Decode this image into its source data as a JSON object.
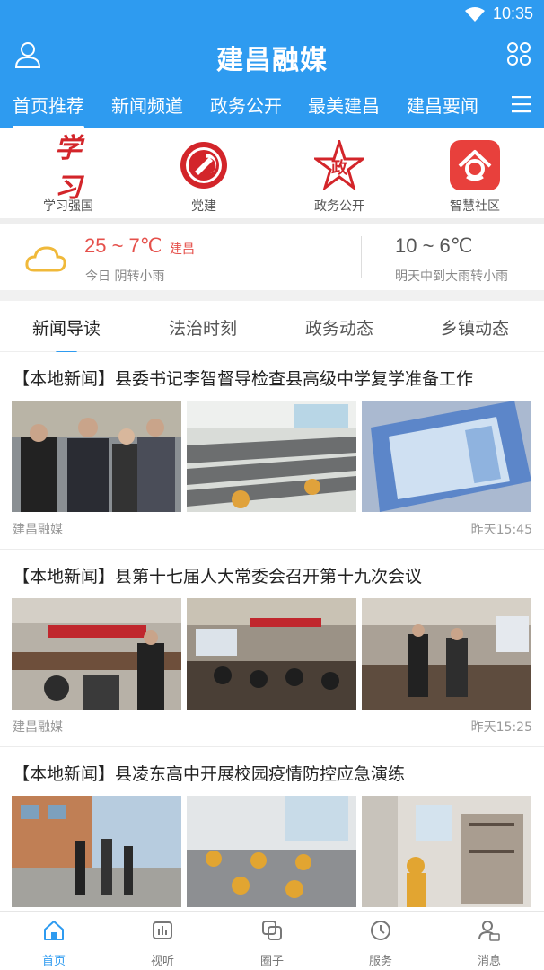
{
  "status_bar": {
    "time": "10:35"
  },
  "header": {
    "title": "建昌融媒"
  },
  "nav_tabs": [
    {
      "label": "首页推荐",
      "active": true
    },
    {
      "label": "新闻频道"
    },
    {
      "label": "政务公开"
    },
    {
      "label": "最美建昌"
    },
    {
      "label": "建昌要闻"
    }
  ],
  "quick_links": [
    {
      "label": "学习强国",
      "icon": "xuexi-logo-icon",
      "logo_text": "学习"
    },
    {
      "label": "党建",
      "icon": "party-emblem-icon"
    },
    {
      "label": "政务公开",
      "icon": "government-star-icon",
      "logo_text": "政"
    },
    {
      "label": "智慧社区",
      "icon": "smart-community-icon"
    }
  ],
  "weather": {
    "today": {
      "temp": "25 ~ 7℃",
      "city": "建昌",
      "desc": "今日 阴转小雨"
    },
    "tomorrow": {
      "temp": "10 ~ 6℃",
      "desc": "明天中到大雨转小雨"
    }
  },
  "sub_tabs": [
    {
      "label": "新闻导读",
      "active": true
    },
    {
      "label": "法治时刻"
    },
    {
      "label": "政务动态"
    },
    {
      "label": "乡镇动态"
    }
  ],
  "articles": [
    {
      "title": "【本地新闻】县委书记李智督导检查县高级中学复学准备工作",
      "source": "建昌融媒",
      "time": "昨天15:45"
    },
    {
      "title": "【本地新闻】县第十七届人大常委会召开第十九次会议",
      "source": "建昌融媒",
      "time": "昨天15:25"
    },
    {
      "title": "【本地新闻】县凌东高中开展校园疫情防控应急演练",
      "source": "",
      "time": ""
    }
  ],
  "bottom_nav": [
    {
      "label": "首页",
      "icon": "home-icon",
      "active": true
    },
    {
      "label": "视听",
      "icon": "video-icon"
    },
    {
      "label": "圈子",
      "icon": "circle-icon"
    },
    {
      "label": "服务",
      "icon": "clock-icon"
    },
    {
      "label": "消息",
      "icon": "message-user-icon"
    }
  ],
  "colors": {
    "primary": "#2e9bf0",
    "accent_red": "#e5504b"
  }
}
